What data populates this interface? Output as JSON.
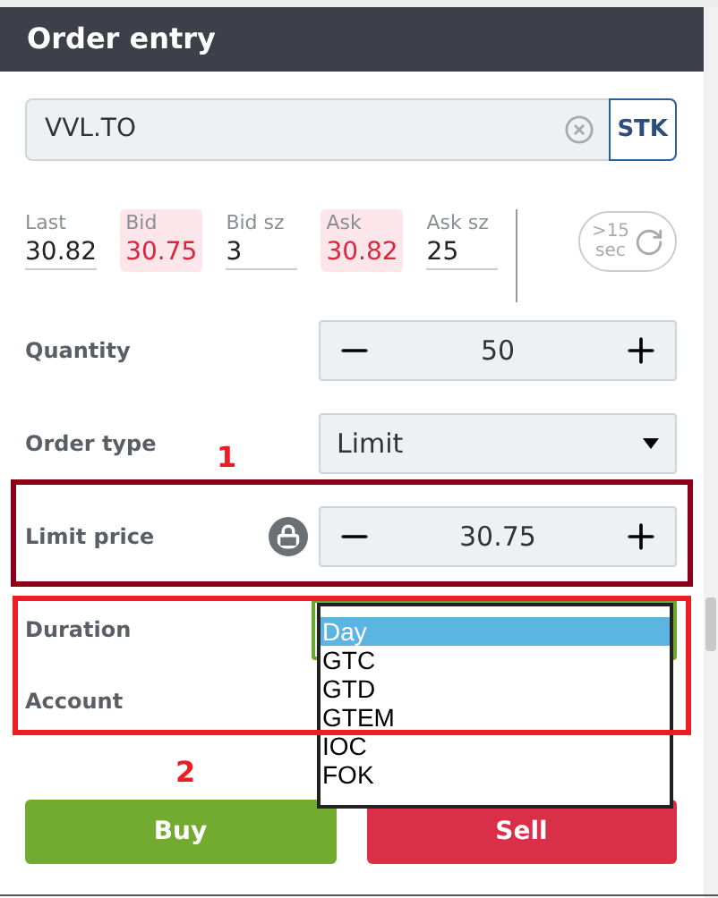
{
  "panel": {
    "title": "Order entry"
  },
  "symbol": {
    "value": "VVL.TO",
    "type_button": "STK"
  },
  "quotes": [
    {
      "label": "Last",
      "value": "30.82",
      "highlight": false
    },
    {
      "label": "Bid",
      "value": "30.75",
      "highlight": true
    },
    {
      "label": "Bid sz",
      "value": "3",
      "highlight": false
    },
    {
      "label": "Ask",
      "value": "30.82",
      "highlight": true
    },
    {
      "label": "Ask sz",
      "value": "25",
      "highlight": false
    }
  ],
  "delayed": {
    "top": ">15",
    "bottom": "sec"
  },
  "fields": [
    {
      "kind": "stepper",
      "label": "Quantity",
      "value": "50",
      "locked": false
    },
    {
      "kind": "select",
      "label": "Order type",
      "value": "Limit"
    },
    {
      "kind": "stepper",
      "label": "Limit price",
      "value": "30.75",
      "locked": true
    },
    {
      "kind": "dropdown",
      "label": "Duration",
      "options": [
        {
          "label": "Day",
          "selected": true
        },
        {
          "label": "GTC",
          "selected": false
        },
        {
          "label": "GTD",
          "selected": false
        },
        {
          "label": "GTEM",
          "selected": false
        },
        {
          "label": "IOC",
          "selected": false
        },
        {
          "label": "FOK",
          "selected": false
        }
      ]
    },
    {
      "kind": "label",
      "label": "Account"
    }
  ],
  "annotations": [
    {
      "label": "1"
    },
    {
      "label": "2"
    }
  ],
  "buttons": [
    {
      "label": "Buy",
      "kind": "buy"
    },
    {
      "label": "Sell",
      "kind": "sell"
    }
  ]
}
